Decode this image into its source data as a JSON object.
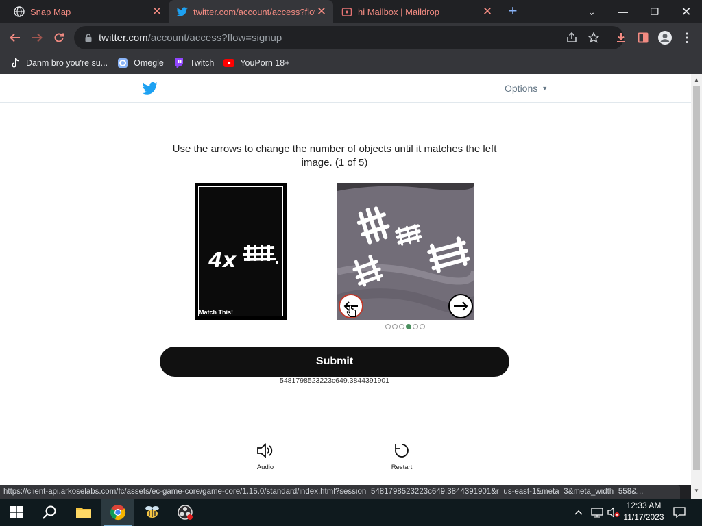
{
  "browser": {
    "tabs": [
      {
        "title": "Snap Map",
        "favicon": "globe-icon"
      },
      {
        "title": "twitter.com/account/access?flow",
        "favicon": "twitter-icon",
        "active": true
      },
      {
        "title": "hi Mailbox | Maildrop",
        "favicon": "maildrop-icon"
      }
    ],
    "url_domain": "twitter.com",
    "url_path": "/account/access?flow=signup",
    "bookmarks": [
      {
        "label": "Danm bro you're su...",
        "icon": "tiktok-icon"
      },
      {
        "label": "Omegle",
        "icon": "omegle-icon"
      },
      {
        "label": "Twitch",
        "icon": "twitch-icon"
      },
      {
        "label": "YouPorn 18+",
        "icon": "youtube-style-icon"
      }
    ],
    "status_url": "https://client-api.arkoselabs.com/fc/assets/ec-game-core/game-core/1.15.0/standard/index.html?session=5481798523223c649.3844391901&r=us-east-1&meta=3&meta_width=558&..."
  },
  "page": {
    "options_label": "Options",
    "instruction": "Use the arrows to change the number of objects until it matches the left image. (1 of 5)",
    "match_text": "4x",
    "match_label": "Match This!",
    "carousel": {
      "total": 6,
      "active_index": 3
    },
    "submit_label": "Submit",
    "session_id": "5481798523223c649.3844391901",
    "audio_label": "Audio",
    "restart_label": "Restart"
  },
  "taskbar": {
    "apps": [
      "start-icon",
      "search-icon",
      "file-explorer-icon",
      "chrome-icon",
      "bee-app-icon",
      "obs-icon"
    ],
    "time": "12:33 AM",
    "date": "11/17/2023"
  },
  "colors": {
    "accent": "#f28b82",
    "twitter_blue": "#1da1f2",
    "submit_bg": "#111111"
  }
}
